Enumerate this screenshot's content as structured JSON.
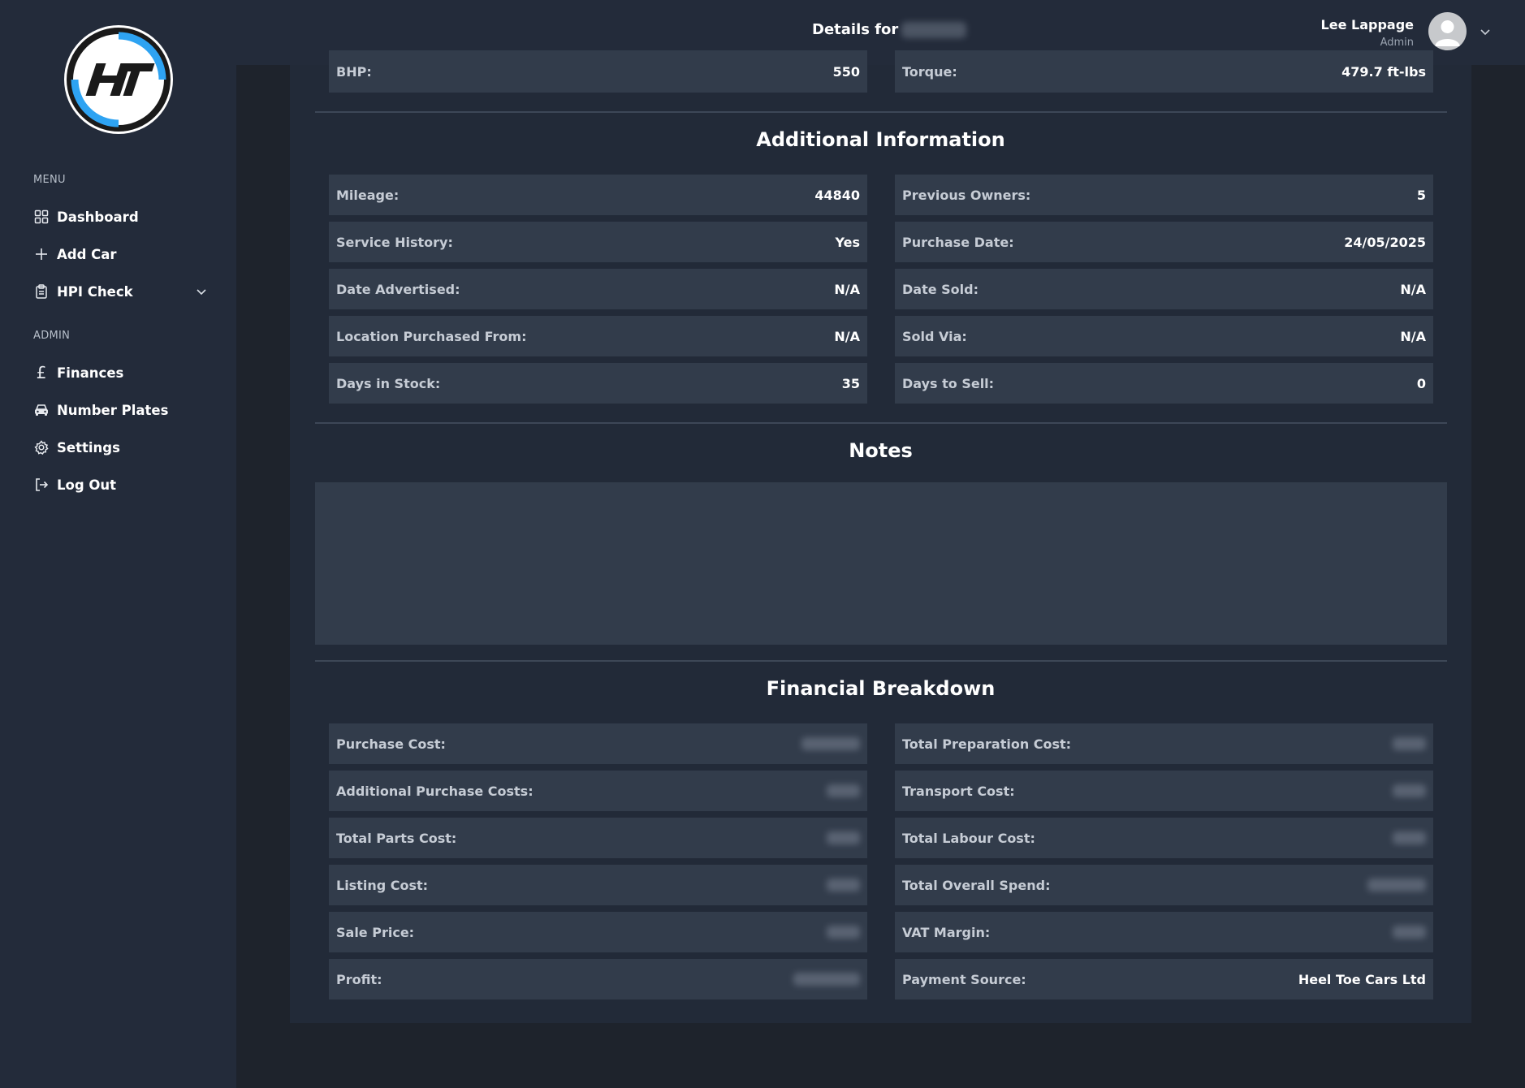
{
  "header": {
    "title_prefix": "Details for",
    "title_subject": "•••••••",
    "user_name": "Lee Lappage",
    "user_role": "Admin"
  },
  "sidebar": {
    "menu_heading": "MENU",
    "menu_items": [
      {
        "label": "Dashboard",
        "icon": "grid-icon"
      },
      {
        "label": "Add Car",
        "icon": "plus-icon"
      },
      {
        "label": "HPI Check",
        "icon": "clipboard-icon"
      }
    ],
    "admin_heading": "ADMIN",
    "admin_items": [
      {
        "label": "Finances",
        "icon": "pound-icon"
      },
      {
        "label": "Number Plates",
        "icon": "car-icon"
      },
      {
        "label": "Settings",
        "icon": "gear-icon"
      },
      {
        "label": "Log Out",
        "icon": "logout-icon"
      }
    ]
  },
  "specs": [
    {
      "label": "BHP:",
      "value": "550"
    },
    {
      "label": "Torque:",
      "value": "479.7 ft-lbs"
    }
  ],
  "additional": {
    "title": "Additional Information",
    "rows": [
      {
        "label": "Mileage:",
        "value": "44840"
      },
      {
        "label": "Previous Owners:",
        "value": "5"
      },
      {
        "label": "Service History:",
        "value": "Yes"
      },
      {
        "label": "Purchase Date:",
        "value": "24/05/2025"
      },
      {
        "label": "Date Advertised:",
        "value": "N/A"
      },
      {
        "label": "Date Sold:",
        "value": "N/A"
      },
      {
        "label": "Location Purchased From:",
        "value": "N/A"
      },
      {
        "label": "Sold Via:",
        "value": "N/A"
      },
      {
        "label": "Days in Stock:",
        "value": "35"
      },
      {
        "label": "Days to Sell:",
        "value": "0"
      }
    ]
  },
  "notes": {
    "title": "Notes",
    "value": ""
  },
  "financial": {
    "title": "Financial Breakdown",
    "rows": [
      {
        "label": "Purchase Cost:",
        "value": "•••••••"
      },
      {
        "label": "Total Preparation Cost:",
        "value": "••••"
      },
      {
        "label": "Additional Purchase Costs:",
        "value": "••••"
      },
      {
        "label": "Transport Cost:",
        "value": "••••"
      },
      {
        "label": "Total Parts Cost:",
        "value": "••••"
      },
      {
        "label": "Total Labour Cost:",
        "value": "••••"
      },
      {
        "label": "Listing Cost:",
        "value": "••••"
      },
      {
        "label": "Total Overall Spend:",
        "value": "•••••••"
      },
      {
        "label": "Sale Price:",
        "value": "••••"
      },
      {
        "label": "VAT Margin:",
        "value": "••••"
      },
      {
        "label": "Profit:",
        "value": "••••••••"
      },
      {
        "label": "Payment Source:",
        "value": "Heel Toe Cars Ltd"
      }
    ]
  },
  "colors": {
    "page_bg": "#1e232c",
    "sidebar_bg": "#232b3a",
    "card_bg": "#222a38",
    "row_bg": "#323c4b",
    "accent_blue": "#2ea3f2"
  }
}
